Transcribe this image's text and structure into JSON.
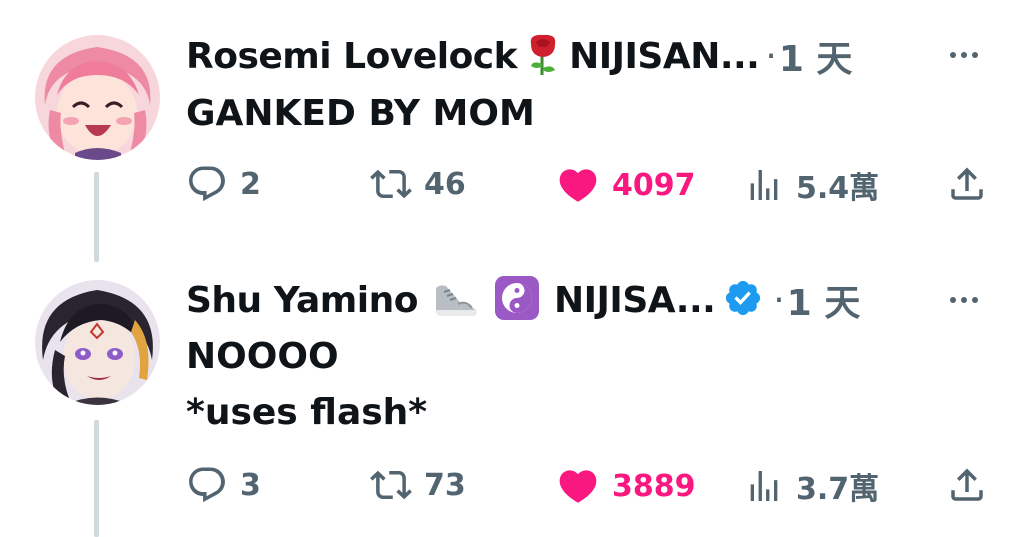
{
  "tweets": [
    {
      "author": "Rosemi Lovelock",
      "name_suffix": "NIJISAN...",
      "separator": "·",
      "time": "1 天",
      "lines": [
        "GANKED BY MOM"
      ],
      "icons": [
        "rose-emoji"
      ],
      "replies": "2",
      "retweets": "46",
      "likes": "4097",
      "views": "5.4萬",
      "liked": true
    },
    {
      "author": "Shu Yamino",
      "name_suffix": "NIJISA...",
      "separator": "·",
      "time": "1 天",
      "lines": [
        "NOOOO",
        "*uses flash*"
      ],
      "icons": [
        "sneaker-emoji",
        "yin-yang-emoji",
        "verified-badge-icon"
      ],
      "replies": "3",
      "retweets": "73",
      "likes": "3889",
      "views": "3.7萬",
      "liked": true
    }
  ],
  "colors": {
    "like": "#f91880",
    "muted": "#536471",
    "verified": "#1d9bf0",
    "thread_line": "#cfd9de"
  }
}
